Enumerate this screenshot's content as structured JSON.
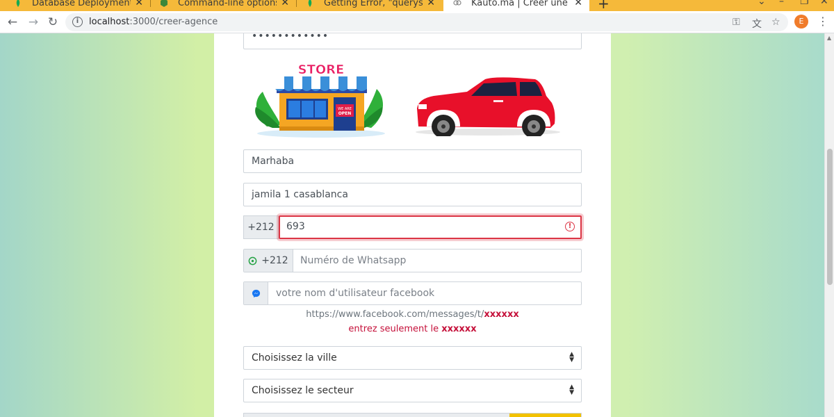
{
  "browser": {
    "tabs": [
      {
        "title": "Database Deployments | ",
        "active": false
      },
      {
        "title": "Command-line options | ",
        "active": false
      },
      {
        "title": "Getting Error, \"queryserv",
        "active": false
      },
      {
        "title": "Kauto.ma | Créer une age",
        "active": true
      }
    ],
    "address_host": "localhost",
    "address_path": ":3000/creer-agence",
    "profile_initial": "E"
  },
  "form": {
    "password_mask": "••••••••••••",
    "illustrations": {
      "store_text": "STORE",
      "store_sign": "WE ARE OPEN"
    },
    "agency_name": "Marhaba",
    "address": "jamila 1 casablanca",
    "phone_prefix": "+212",
    "phone_value": "693",
    "whatsapp_prefix": "+212",
    "whatsapp_placeholder": "Numéro de Whatsapp",
    "facebook_placeholder": "votre nom d'utilisateur facebook",
    "facebook_hint_url": "https://www.facebook.com/messages/t/",
    "facebook_hint_url_bold": "xxxxxx",
    "facebook_hint_note": "entrez seulement le ",
    "facebook_hint_note_bold": "xxxxxx",
    "city_select": "Choisissez la ville",
    "sector_select": "Choisissez le secteur"
  }
}
